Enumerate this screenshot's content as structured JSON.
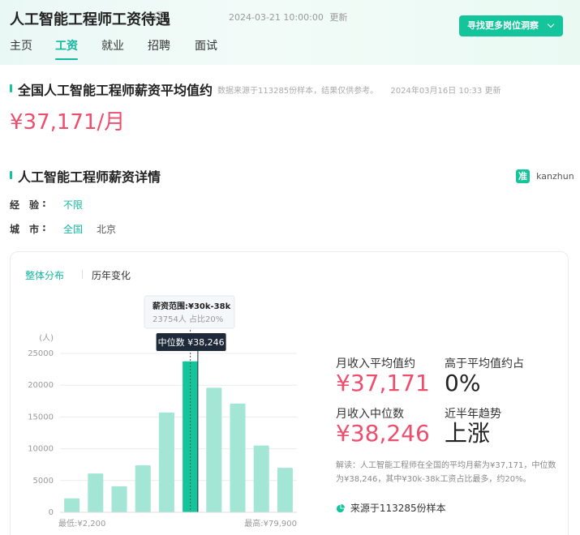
{
  "header": {
    "title": "人工智能工程师工资待遇",
    "update_time": "2024-03-21 10:00:00",
    "update_suffix": "更新",
    "cta_label": "寻找更多岗位洞察",
    "info_icon": "info-circle-icon",
    "chevron_icon": "chevron-down-icon"
  },
  "tabs": [
    {
      "label": "主页",
      "active": false
    },
    {
      "label": "工资",
      "active": true
    },
    {
      "label": "就业",
      "active": false
    },
    {
      "label": "招聘",
      "active": false
    },
    {
      "label": "面试",
      "active": false
    }
  ],
  "average_section": {
    "title": "全国人工智能工程师薪资平均值约",
    "source_note": "数据来源于113285份样本，结果仅供参考。",
    "update_note": "2024年03月16日 10:33 更新",
    "value": "¥37,171/月"
  },
  "detail_section": {
    "title": "人工智能工程师薪资详情",
    "brand_logo_char": "准",
    "brand_name": "kanzhun",
    "filters": [
      {
        "label": "经",
        "label2": "验",
        "colon": ":",
        "options": [
          {
            "label": "不限",
            "active": true
          }
        ]
      },
      {
        "label": "城",
        "label2": "市",
        "colon": ":",
        "options": [
          {
            "label": "全国",
            "active": true
          },
          {
            "label": "北京",
            "active": false
          }
        ]
      }
    ]
  },
  "card": {
    "subtabs": [
      {
        "label": "整体分布",
        "active": true
      },
      {
        "label": "历年变化",
        "active": false
      }
    ],
    "stats": {
      "avg_label": "月收入平均值约",
      "avg_value": "¥37,171",
      "above_label": "高于平均值约占",
      "above_value": "0%",
      "median_label": "月收入中位数",
      "median_value": "¥38,246",
      "trend_label": "近半年趋势",
      "trend_value": "上涨"
    },
    "description": "解读：人工智能工程师在全国的平均月薪为¥37,171，中位数为¥38,246，其中¥30k-38k工资占比最多，约20%。",
    "source": "来源于113285份样本",
    "source_icon": "pie-chart-icon"
  },
  "chart_data": {
    "type": "bar",
    "ylabel": "(人)",
    "ylim": [
      0,
      25000
    ],
    "yticks": [
      0,
      5000,
      10000,
      15000,
      20000,
      25000
    ],
    "values": [
      2200,
      6100,
      4100,
      7400,
      15700,
      23754,
      19600,
      17100,
      10500,
      7000
    ],
    "highlight_index": 5,
    "min_label": "最低:¥2,200",
    "max_label": "最高:¥79,900",
    "tooltip": {
      "title": "薪资范围:¥30k-38k",
      "detail": "23754人  占比20%"
    },
    "median_label": "中位数 ¥38,246",
    "median_position": 5.75,
    "colors": {
      "bar": "#a3e6d5",
      "highlight": "#14c49b",
      "median_line": "#1e2a3a",
      "grid": "#ececec"
    }
  }
}
